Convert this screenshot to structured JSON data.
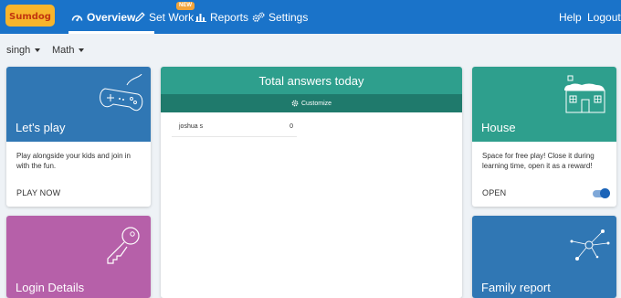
{
  "nav": {
    "logo_text": "Sumdog",
    "items": [
      {
        "label": "Overview",
        "icon": "dashboard-icon",
        "active": true
      },
      {
        "label": "Set Work",
        "icon": "pencil-icon",
        "badge": "NEW"
      },
      {
        "label": "Reports",
        "icon": "bar-chart-icon"
      },
      {
        "label": "Settings",
        "icon": "gears-icon"
      }
    ],
    "help_label": "Help",
    "logout_label": "Logout"
  },
  "filters": {
    "child": "singh",
    "subject": "Math"
  },
  "cards": {
    "lets_play": {
      "title": "Let's play",
      "description": "Play alongside your kids and join in with the fun.",
      "action": "PLAY NOW",
      "color": "#3077b4",
      "icon": "gamepad-icon"
    },
    "login_details": {
      "title": "Login Details",
      "color": "#b660a9",
      "icon": "key-icon"
    },
    "answers": {
      "title": "Total answers today",
      "customize_label": "Customize",
      "header_color": "#2e9f8d",
      "sub_color": "#1f7a6c",
      "rows": [
        {
          "name": "joshua s",
          "count": "0"
        }
      ]
    },
    "house": {
      "title": "House",
      "description": "Space for free play! Close it during learning time, open it as a reward!",
      "action": "OPEN",
      "color": "#2e9f8d",
      "icon": "house-icon",
      "toggle_on": true
    },
    "family_report": {
      "title": "Family report",
      "color": "#3077b4",
      "icon": "network-icon"
    }
  }
}
